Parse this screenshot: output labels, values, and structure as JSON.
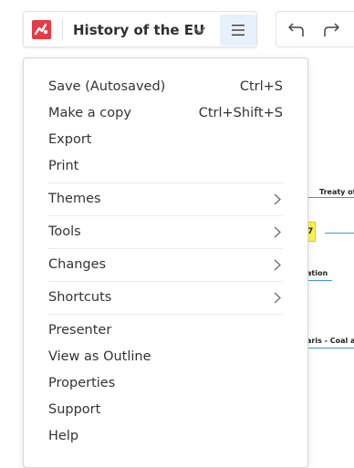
{
  "header": {
    "doc_title": "History of the EU",
    "icons": {
      "logo": "app-logo-icon",
      "title_dropdown": "chevron-down-icon",
      "menu": "hamburger-menu-icon",
      "undo": "undo-arrow-icon",
      "redo": "redo-arrow-icon"
    },
    "colors": {
      "logo": "#e63a46",
      "menu_button_active": "#e7f1fb",
      "connector_line": "#3b9bd8",
      "highlight_node": "#fff34d"
    }
  },
  "canvas": {
    "node_treaty": "Treaty of",
    "node_year": "7",
    "node_ation": "ation",
    "node_paris": "aris - Coal a"
  },
  "menu": {
    "save": {
      "label": "Save (Autosaved)",
      "shortcut": "Ctrl+S"
    },
    "copy": {
      "label": "Make a copy",
      "shortcut": "Ctrl+Shift+S"
    },
    "export": {
      "label": "Export"
    },
    "print": {
      "label": "Print"
    },
    "themes": {
      "label": "Themes"
    },
    "tools": {
      "label": "Tools"
    },
    "changes": {
      "label": "Changes"
    },
    "shortcuts": {
      "label": "Shortcuts"
    },
    "presenter": {
      "label": "Presenter"
    },
    "outline": {
      "label": "View as Outline"
    },
    "properties": {
      "label": "Properties"
    },
    "support": {
      "label": "Support"
    },
    "help": {
      "label": "Help"
    }
  }
}
